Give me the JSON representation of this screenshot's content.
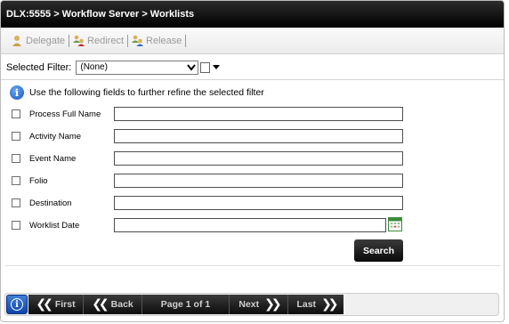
{
  "window": {
    "title": "DLX:5555 > Workflow Server > Worklists"
  },
  "toolbar": {
    "delegate_label": "Delegate",
    "redirect_label": "Redirect",
    "release_label": "Release"
  },
  "filter": {
    "label": "Selected Filter:",
    "selected_value": "(None)"
  },
  "info": {
    "text": "Use the following fields to further refine the selected filter"
  },
  "fields": [
    {
      "label": "Process Full Name",
      "value": "",
      "checked": false
    },
    {
      "label": "Activity Name",
      "value": "",
      "checked": false
    },
    {
      "label": "Event Name",
      "value": "",
      "checked": false
    },
    {
      "label": "Folio",
      "value": "",
      "checked": false
    },
    {
      "label": "Destination",
      "value": "",
      "checked": false
    },
    {
      "label": "Worklist Date",
      "value": "",
      "checked": false
    }
  ],
  "search_button": {
    "label": "Search"
  },
  "pager": {
    "first_label": "First",
    "back_label": "Back",
    "page_text": "Page 1 of 1",
    "next_label": "Next",
    "last_label": "Last"
  },
  "colors": {
    "title_bg": "#000000",
    "accent_blue": "#1456b8",
    "disabled_text": "#9a9a9a"
  }
}
